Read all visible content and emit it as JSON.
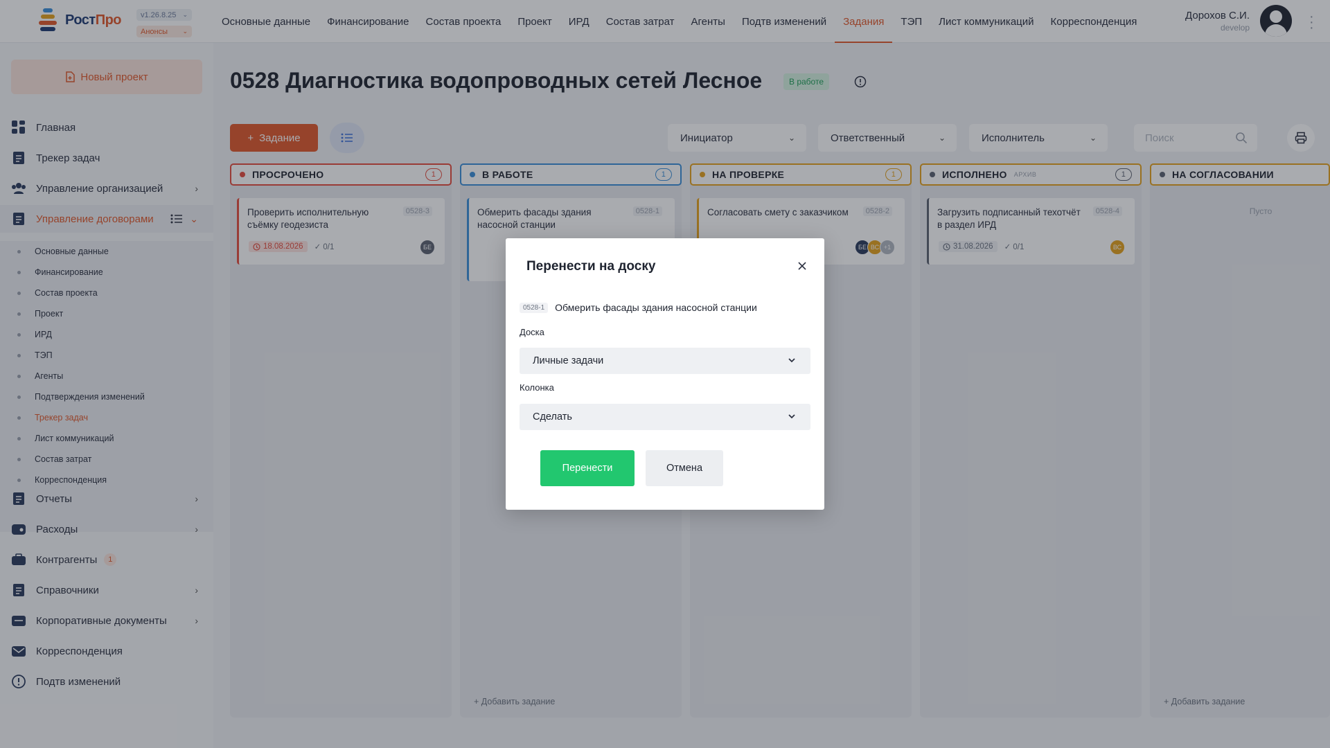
{
  "app": {
    "logo_text_a": "Рост",
    "logo_text_b": "Про",
    "version": "v1.26.8.25",
    "announcements": "Анонсы"
  },
  "nav": [
    {
      "label": "Основные данные",
      "active": false
    },
    {
      "label": "Финансирование",
      "active": false
    },
    {
      "label": "Состав проекта",
      "active": false
    },
    {
      "label": "Проект",
      "active": false
    },
    {
      "label": "ИРД",
      "active": false
    },
    {
      "label": "Состав затрат",
      "active": false
    },
    {
      "label": "Агенты",
      "active": false
    },
    {
      "label": "Подтв изменений",
      "active": false
    },
    {
      "label": "Задания",
      "active": true
    },
    {
      "label": "ТЭП",
      "active": false
    },
    {
      "label": "Лист коммуникаций",
      "active": false
    },
    {
      "label": "Корреспонденция",
      "active": false
    }
  ],
  "user": {
    "name": "Дорохов С.И.",
    "role": "develop"
  },
  "sidebar": {
    "new_project": "Новый проект",
    "items": [
      {
        "label": "Главная",
        "icon": "dashboard-icon"
      },
      {
        "label": "Трекер задач",
        "icon": "tasks-icon"
      },
      {
        "label": "Управление организацией",
        "icon": "users-icon"
      },
      {
        "label": "Управление договорами",
        "icon": "contract-icon"
      },
      {
        "label": "Отчеты",
        "icon": "report-icon"
      },
      {
        "label": "Расходы",
        "icon": "wallet-icon"
      },
      {
        "label": "Контрагенты",
        "icon": "briefcase-icon",
        "badge": "1"
      },
      {
        "label": "Справочники",
        "icon": "book-icon"
      },
      {
        "label": "Корпоративные документы",
        "icon": "folder-icon"
      },
      {
        "label": "Корреспонденция",
        "icon": "mail-icon"
      },
      {
        "label": "Подтв изменений",
        "icon": "alert-icon"
      }
    ],
    "sub_items": [
      "Основные данные",
      "Финансирование",
      "Состав проекта",
      "Проект",
      "ИРД",
      "ТЭП",
      "Агенты",
      "Подтверждения изменений",
      "Трекер задач",
      "Лист коммуникаций",
      "Состав затрат",
      "Корреспонденция"
    ]
  },
  "page": {
    "title": "0528 Диагностика водопроводных сетей Лесное",
    "status": "В работе"
  },
  "toolbar": {
    "add_task": "Задание",
    "filters": [
      "Инициатор",
      "Ответственный",
      "Исполнитель"
    ],
    "search_placeholder": "Поиск"
  },
  "columns": [
    {
      "title": "ПРОСРОЧЕНО",
      "count": "1",
      "color": "#e54b3c",
      "card": {
        "title": "Проверить исполнительную съёмку геодезиста",
        "id": "0528-3",
        "date": "18.08.2026",
        "checks": "0/1",
        "avatars": [
          "БЕ"
        ]
      }
    },
    {
      "title": "В РАБОТЕ",
      "count": "1",
      "color": "#3b8fd9",
      "card": {
        "title": "Обмерить фасады здания насосной станции",
        "id": "0528-1"
      },
      "add": "Добавить задание"
    },
    {
      "title": "НА ПРОВЕРКЕ",
      "count": "1",
      "color": "#e6a21c",
      "card": {
        "title": "Согласовать смету с заказчиком",
        "id": "0528-2",
        "avatars": [
          "БЕ",
          "ВС",
          "+1"
        ]
      }
    },
    {
      "title": "ИСПОЛНЕНО",
      "count": "1",
      "color": "#5b6170",
      "archive": "АРХИВ",
      "card": {
        "title": "Загрузить подписанный техотчёт в раздел ИРД",
        "id": "0528-4",
        "date": "31.08.2026",
        "checks": "0/1",
        "avatars": [
          "ВС"
        ]
      }
    },
    {
      "title": "НА СОГЛАСОВАНИИ",
      "color": "#5b6170",
      "empty": "Пусто",
      "add": "Добавить задание"
    }
  ],
  "modal": {
    "title": "Перенести на доску",
    "task_id": "0528-1",
    "task_title": "Обмерить фасады здания насосной станции",
    "board_label": "Доска",
    "board_value": "Личные задачи",
    "column_label": "Колонка",
    "column_value": "Сделать",
    "confirm": "Перенести",
    "cancel": "Отмена"
  }
}
